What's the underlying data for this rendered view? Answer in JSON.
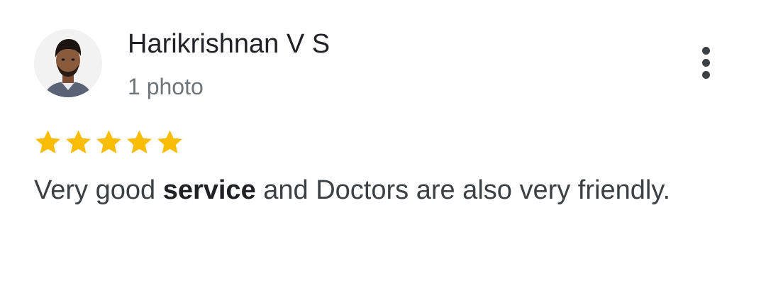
{
  "reviewer": {
    "name": "Harikrishnan V S",
    "meta": "1 photo",
    "avatar_icon": "person-photo-avatar"
  },
  "menu": {
    "icon": "more-vertical-icon"
  },
  "rating": {
    "stars": 5,
    "max": 5,
    "color": "#fbbc04"
  },
  "review": {
    "text_before": "Very good ",
    "text_highlight": "service",
    "text_after": " and Doctors are also very friendly."
  },
  "colors": {
    "name": "#202124",
    "meta": "#70757a",
    "body": "#3c4043",
    "star": "#fbbc04"
  }
}
